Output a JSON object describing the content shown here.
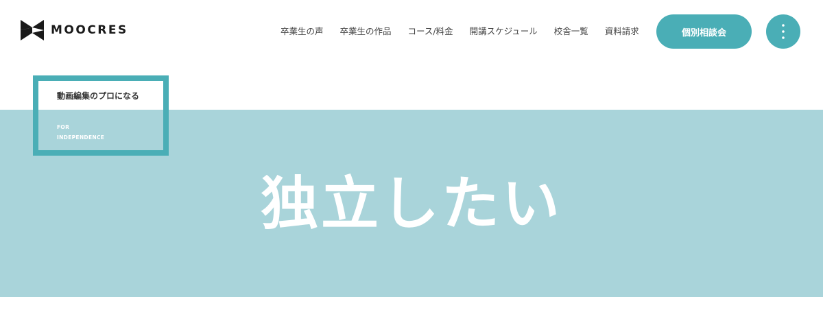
{
  "brand": {
    "name": "MOOCRES",
    "logo_icon": "moocres-logo-mark",
    "accent_color": "#4aaeb6",
    "hero_color": "#a9d4da"
  },
  "nav": {
    "items": [
      {
        "label": "卒業生の声"
      },
      {
        "label": "卒業生の作品"
      },
      {
        "label": "コース/料金"
      },
      {
        "label": "開講スケジュール"
      },
      {
        "label": "校舎一覧"
      },
      {
        "label": "資料請求"
      }
    ],
    "cta_label": "個別相談会",
    "menu_icon": "kebab-menu-icon"
  },
  "label_box": {
    "title": "動画編集のプロになる",
    "subtitle_lines": [
      "FOR",
      "INDEPENDENCE"
    ]
  },
  "hero": {
    "title": "独立したい"
  }
}
